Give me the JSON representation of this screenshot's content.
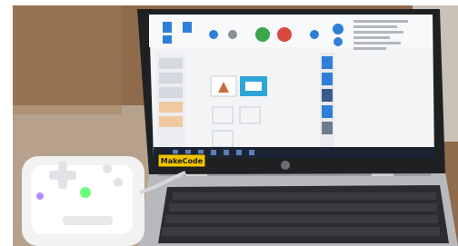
{
  "photo": {
    "subject": "laptop-with-robot-controller",
    "colors": {
      "wood": "#8f6a4b",
      "wall": "#d8d2c8",
      "laptop_silver": "#b9babd",
      "keyboard": "#2a2b2d",
      "screen_bg": "#f3f4f6",
      "taskbar": "#1c2433",
      "accent_blue": "#2e7fd8",
      "accent_green": "#3aa54a",
      "accent_red": "#d9463e",
      "sticker": "#f2c400",
      "led_green": "#6dff7a",
      "led_purple": "#b38cff"
    }
  },
  "sticker": {
    "text": "MakeCode"
  }
}
